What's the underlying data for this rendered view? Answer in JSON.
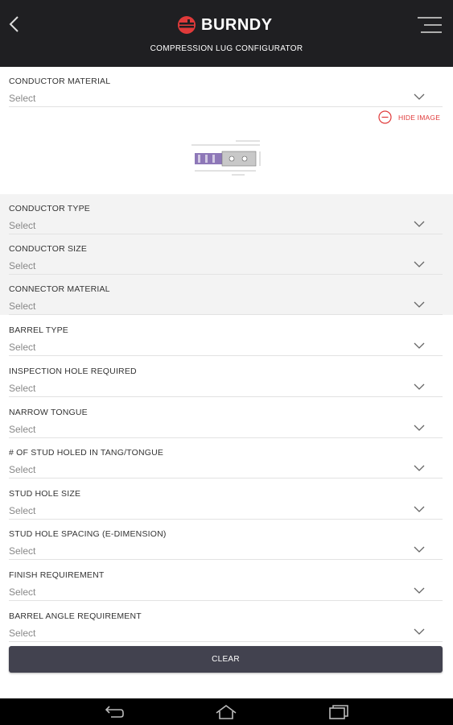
{
  "header": {
    "brand": "BURNDY",
    "subtitle": "COMPRESSION LUG CONFIGURATOR"
  },
  "image_toggle": {
    "label": "HIDE IMAGE"
  },
  "fields": [
    {
      "label": "CONDUCTOR MATERIAL",
      "value": "Select"
    },
    {
      "label": "CONDUCTOR TYPE",
      "value": "Select"
    },
    {
      "label": "CONDUCTOR SIZE",
      "value": "Select"
    },
    {
      "label": "CONNECTOR MATERIAL",
      "value": "Select"
    },
    {
      "label": "BARREL TYPE",
      "value": "Select"
    },
    {
      "label": "INSPECTION HOLE REQUIRED",
      "value": "Select"
    },
    {
      "label": "NARROW TONGUE",
      "value": "Select"
    },
    {
      "label": "# OF STUD HOLED IN TANG/TONGUE",
      "value": "Select"
    },
    {
      "label": "STUD HOLE SIZE",
      "value": "Select"
    },
    {
      "label": "STUD HOLE SPACING (E-DIMENSION)",
      "value": "Select"
    },
    {
      "label": "FINISH REQUIREMENT",
      "value": "Select"
    },
    {
      "label": "BARREL ANGLE REQUIREMENT",
      "value": "Select"
    }
  ],
  "clear_button": {
    "label": "CLEAR"
  },
  "colors": {
    "header_bg": "#1f1f22",
    "accent_red": "#e03a3a",
    "button_bg": "#42424f",
    "shaded_row": "#f3f3f3"
  },
  "icons": [
    "back-arrow-icon",
    "burndy-logo-icon",
    "menu-icon",
    "minus-circle-icon",
    "chevron-down-icon",
    "nav-back-icon",
    "nav-home-icon",
    "nav-recents-icon"
  ]
}
